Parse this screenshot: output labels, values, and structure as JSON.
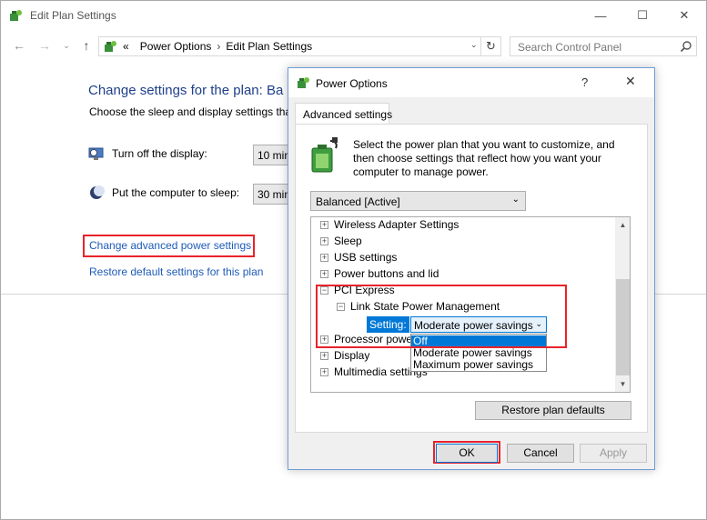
{
  "main_window": {
    "title": "Edit Plan Settings",
    "controls": {
      "minimize": "—",
      "maximize": "☐",
      "close": "✕"
    }
  },
  "navigation": {
    "back": "←",
    "forward": "→",
    "recent": "⌄",
    "up": "↑",
    "breadcrumb_lead": "«",
    "breadcrumb": [
      "Power Options",
      "Edit Plan Settings"
    ],
    "breadcrumb_sep": "›",
    "address_dropdown": "⌄",
    "refresh": "↻",
    "search_placeholder": "Search Control Panel"
  },
  "content": {
    "title": "Change settings for the plan: Ba",
    "subtitle": "Choose the sleep and display settings that",
    "display_label": "Turn off the display:",
    "display_value": "10 min",
    "sleep_label": "Put the computer to sleep:",
    "sleep_value": "30 min",
    "advanced_link": "Change advanced power settings",
    "restore_link": "Restore default settings for this plan"
  },
  "dialog": {
    "title": "Power Options",
    "help": "?",
    "close": "✕",
    "tab": "Advanced settings",
    "description": "Select the power plan that you want to customize, and then choose settings that reflect how you want your computer to manage power.",
    "plan_selected": "Balanced [Active]",
    "tree": [
      {
        "label": "Wireless Adapter Settings",
        "sign": "+"
      },
      {
        "label": "Sleep",
        "sign": "+"
      },
      {
        "label": "USB settings",
        "sign": "+"
      },
      {
        "label": "Power buttons and lid",
        "sign": "+"
      },
      {
        "label": "PCI Express",
        "sign": "−"
      },
      {
        "label": "Link State Power Management",
        "sign": "−"
      },
      {
        "label": "Processor powe",
        "sign": "+"
      },
      {
        "label": "Display",
        "sign": "+"
      },
      {
        "label": "Multimedia settings",
        "sign": "+"
      }
    ],
    "setting_label": "Setting:",
    "setting_value": "Moderate power savings",
    "setting_options": [
      "Off",
      "Moderate power savings",
      "Maximum power savings"
    ],
    "scroll_up": "▲",
    "scroll_down": "▼",
    "chevron": "⌄",
    "restore_button": "Restore plan defaults",
    "ok_button": "OK",
    "cancel_button": "Cancel",
    "apply_button": "Apply"
  },
  "colors": {
    "link": "#1e5bb8",
    "title_blue": "#1e3f8b",
    "highlight_red": "#e8232b",
    "selection_blue": "#0078d7"
  }
}
